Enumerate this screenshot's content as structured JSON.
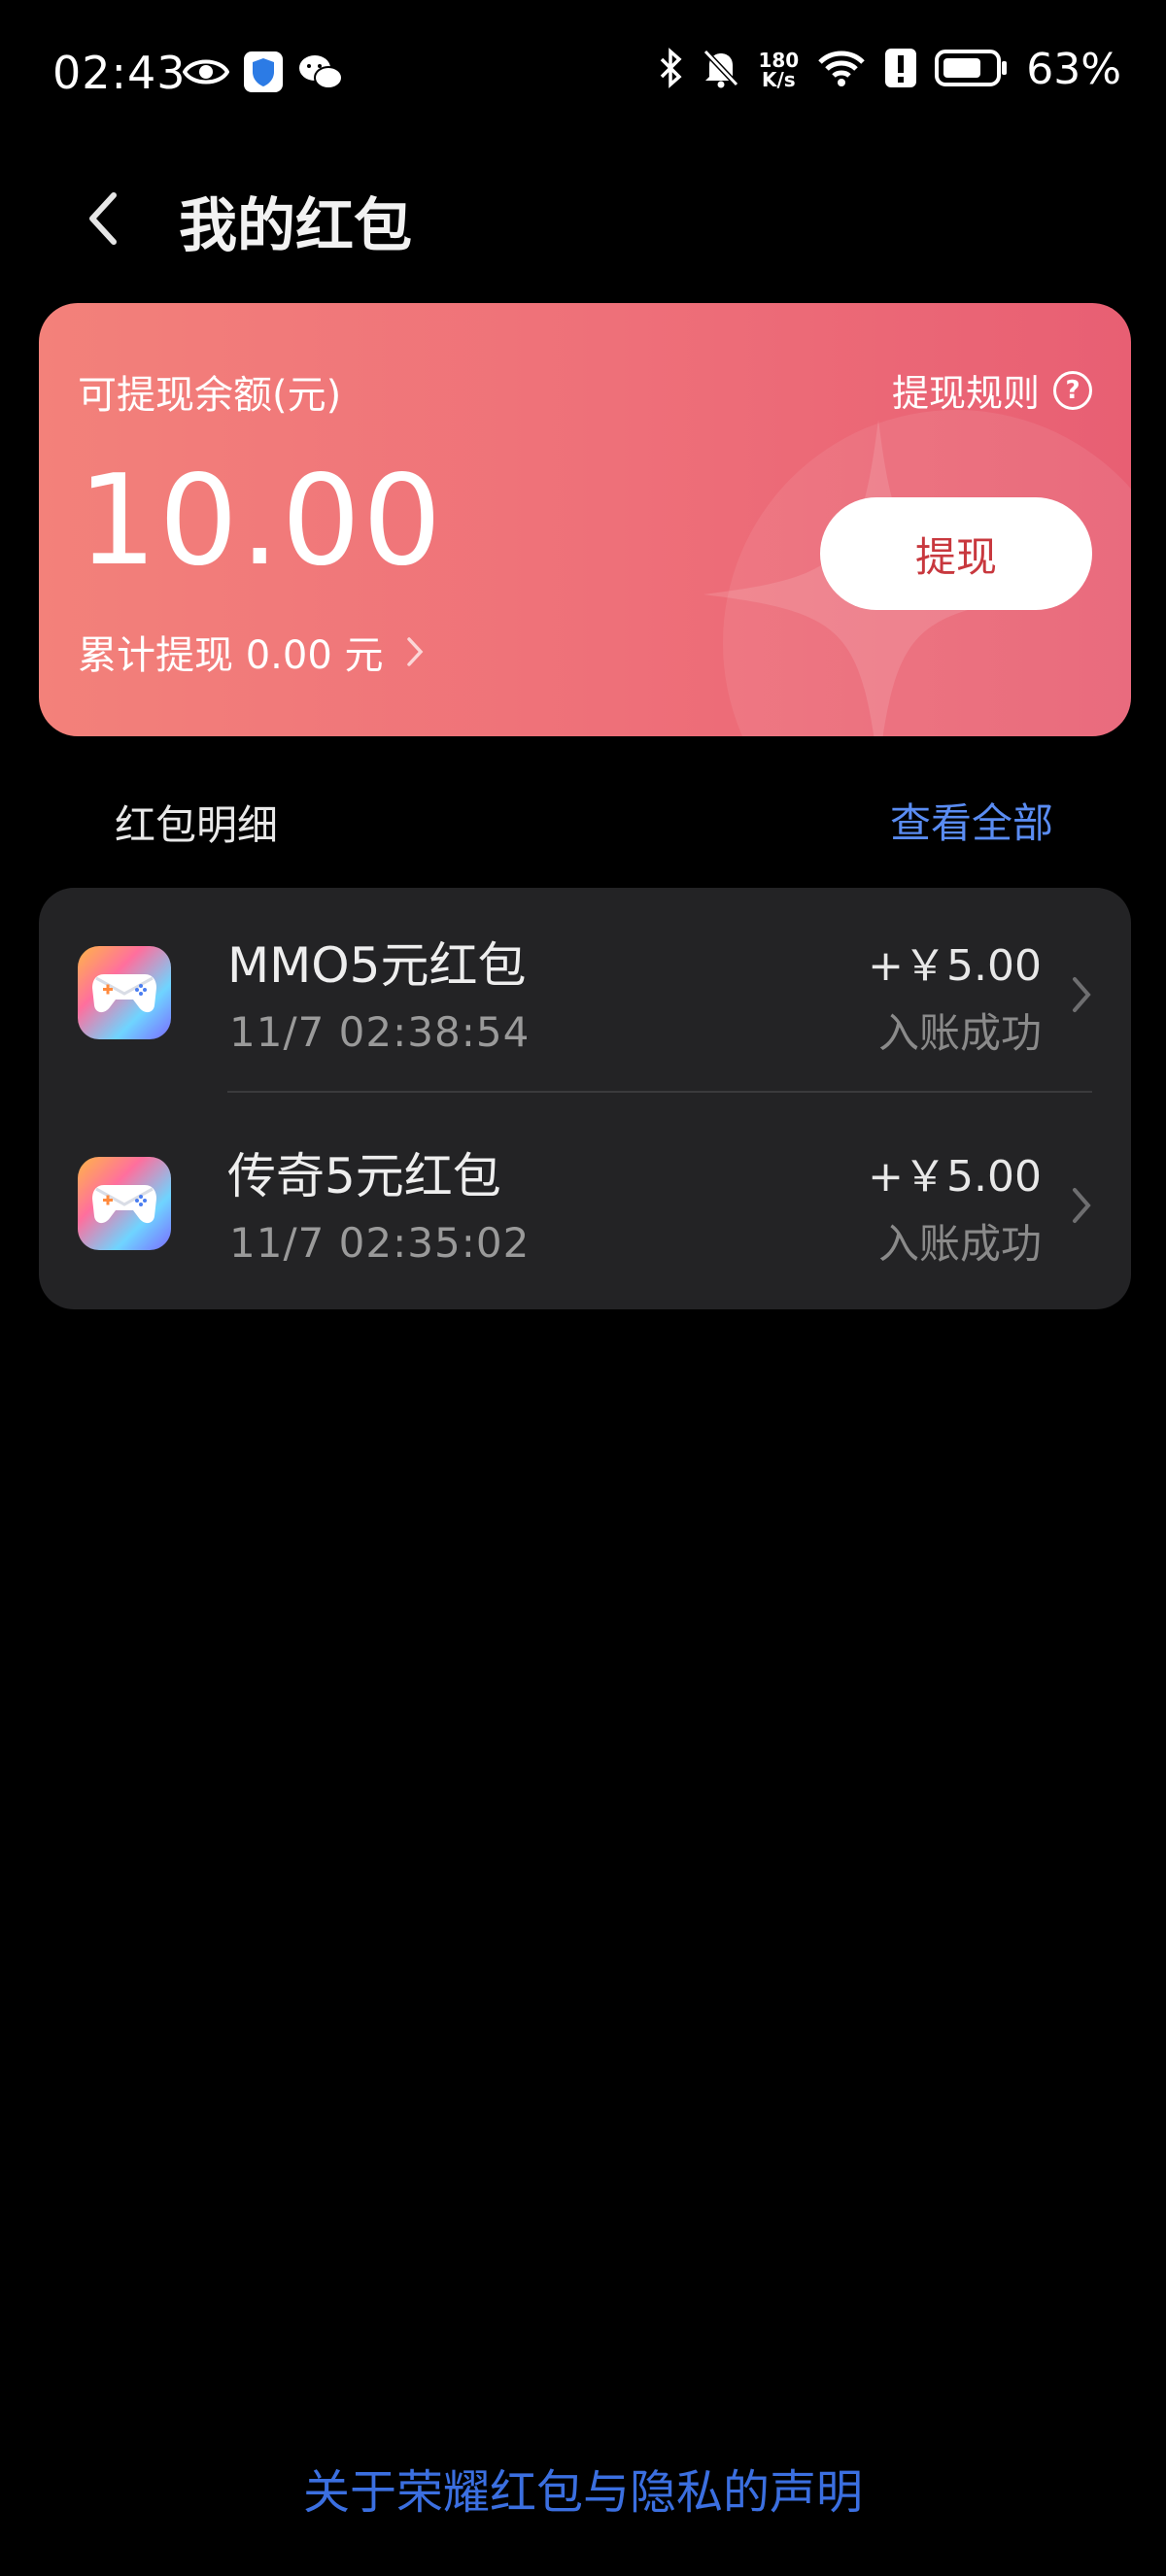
{
  "status_bar": {
    "time": "02:43",
    "net_speed_value": "180",
    "net_speed_unit": "K/s",
    "battery_percent": "63%",
    "icons": [
      "eye-icon",
      "shield-icon",
      "wechat-icon",
      "bluetooth-icon",
      "mute-bell-icon",
      "wifi-icon",
      "alert-icon",
      "battery-icon"
    ]
  },
  "header": {
    "title": "我的红包"
  },
  "balance_card": {
    "label": "可提现余额(元)",
    "rules_label": "提现规则",
    "amount": "10.00",
    "total_withdrawn": "累计提现 0.00 元",
    "withdraw_button": "提现",
    "colors": {
      "gradient_start": "#f3817a",
      "gradient_end": "#e85f73",
      "button_text": "#c8383e"
    }
  },
  "details": {
    "section_title": "红包明细",
    "view_all": "查看全部",
    "items": [
      {
        "title": "MMO5元红包",
        "time": "11/7 02:38:54",
        "amount": "+￥5.00",
        "status": "入账成功"
      },
      {
        "title": "传奇5元红包",
        "time": "11/7 02:35:02",
        "amount": "+￥5.00",
        "status": "入账成功"
      }
    ]
  },
  "footer": {
    "privacy_link": "关于荣耀红包与隐私的声明",
    "link_color": "#3b6fe0"
  }
}
